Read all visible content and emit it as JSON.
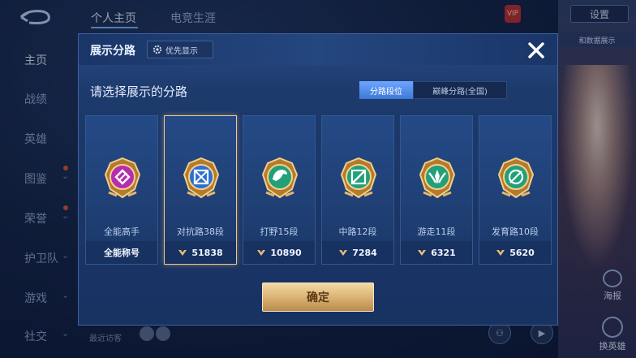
{
  "background": {
    "tabs": [
      "个人主页",
      "电竞生涯"
    ],
    "sidebar": [
      "主页",
      "战绩",
      "英雄",
      "图鉴",
      "荣誉",
      "护卫队",
      "游戏",
      "社交"
    ],
    "settings_label": "设置",
    "vip_label": "VIP",
    "right_tag": "和数据展示",
    "hb_label": "海报",
    "swap_label": "换英雄",
    "visitors_label": "最近访客"
  },
  "modal": {
    "title": "展示分路",
    "priority_label": "优先显示",
    "subtitle": "请选择展示的分路",
    "segments": [
      {
        "label": "分路段位",
        "active": true
      },
      {
        "label": "巅峰分路(全国)",
        "active": false
      }
    ],
    "cards": [
      {
        "label": "全能高手",
        "value": "全能称号",
        "emblem": "purple",
        "selected": false
      },
      {
        "label": "对抗路38段",
        "value": "51838",
        "emblem": "blue",
        "selected": true
      },
      {
        "label": "打野15段",
        "value": "10890",
        "emblem": "green-dragon",
        "selected": false
      },
      {
        "label": "中路12段",
        "value": "7284",
        "emblem": "green",
        "selected": false
      },
      {
        "label": "游走11段",
        "value": "6321",
        "emblem": "green-wing",
        "selected": false
      },
      {
        "label": "发育路10段",
        "value": "5620",
        "emblem": "green-target",
        "selected": false
      }
    ],
    "confirm_label": "确定"
  },
  "colors": {
    "accent_gold": "#e6c07c",
    "segment_active": "#4d8ae8",
    "modal_bg": "#1d3a6c"
  }
}
